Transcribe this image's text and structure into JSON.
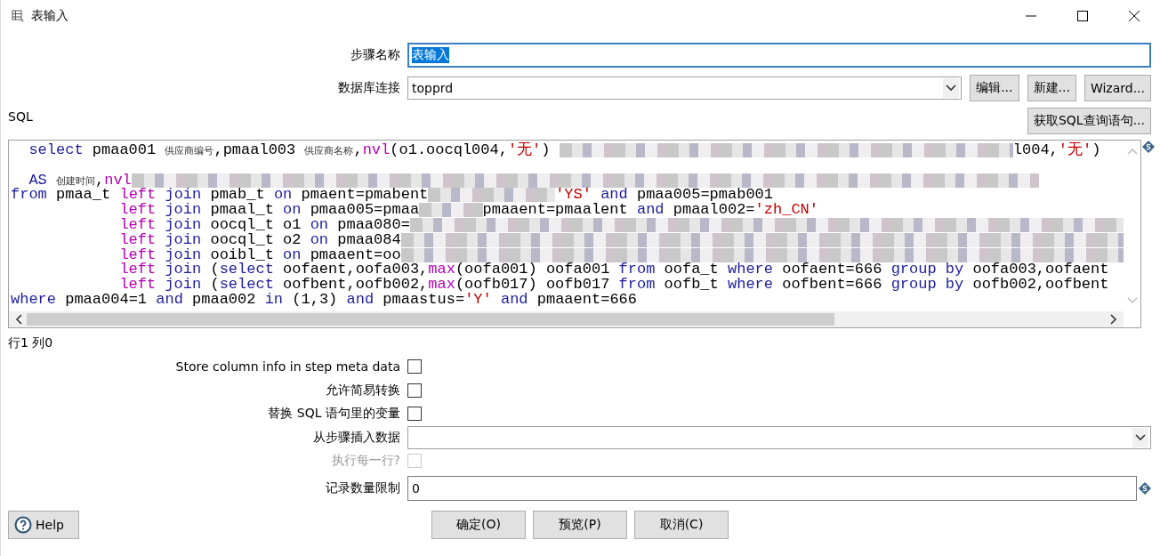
{
  "window": {
    "title": "表输入"
  },
  "step_name": {
    "label": "步骤名称",
    "value": "表输入",
    "selected": true
  },
  "connection": {
    "label": "数据库连接",
    "value": "topprd",
    "buttons": [
      "编辑...",
      "新建...",
      "Wizard..."
    ]
  },
  "sql": {
    "label": "SQL",
    "button": "获取SQL查询语句...",
    "lines": [
      {
        "kind": "lead",
        "tokens": [
          {
            "kind": "kw",
            "text": "select"
          },
          {
            "kind": "plain",
            "text": " pmaa001 "
          },
          {
            "kind": "cjk",
            "text": "供应商编号"
          },
          {
            "kind": "plain",
            "text": ",pmaal003 "
          },
          {
            "kind": "cjk",
            "text": "供应商名称"
          },
          {
            "kind": "plain",
            "text": ","
          },
          {
            "kind": "fn",
            "text": "nvl"
          },
          {
            "kind": "plain",
            "text": "(o1.oocql004,"
          },
          {
            "kind": "str",
            "text": "'无'"
          },
          {
            "kind": "plain",
            "text": ") "
          },
          {
            "kind": "mosaic"
          },
          {
            "kind": "plain",
            "text": "l004,"
          },
          {
            "kind": "str",
            "text": "'无'"
          },
          {
            "kind": "plain",
            "text": ")"
          }
        ]
      },
      {
        "kind": "blank"
      },
      {
        "kind": "lead",
        "tokens": [
          {
            "kind": "kw",
            "text": "AS "
          },
          {
            "kind": "cjk",
            "text": "创建时间"
          },
          {
            "kind": "plain",
            "text": ","
          },
          {
            "kind": "fn",
            "text": "nvl"
          },
          {
            "kind": "mosaic"
          }
        ]
      },
      {
        "kind": "flush",
        "tokens": [
          {
            "kind": "kw",
            "text": "from"
          },
          {
            "kind": "plain",
            "text": " pmaa_t "
          },
          {
            "kind": "fn",
            "text": "left "
          },
          {
            "kind": "kw",
            "text": "join"
          },
          {
            "kind": "plain",
            "text": " pmab_t "
          },
          {
            "kind": "kw",
            "text": "on"
          },
          {
            "kind": "plain",
            "text": " pmaent=pmabent"
          },
          {
            "kind": "mosaic"
          },
          {
            "kind": "str",
            "text": "'YS'"
          },
          {
            "kind": "kw",
            "text": " and"
          },
          {
            "kind": "plain",
            "text": " pmaa005=pmab001"
          }
        ]
      },
      {
        "kind": "nested",
        "tokens": [
          {
            "kind": "fn",
            "text": "left "
          },
          {
            "kind": "kw",
            "text": "join"
          },
          {
            "kind": "plain",
            "text": " pmaal_t "
          },
          {
            "kind": "kw",
            "text": "on"
          },
          {
            "kind": "plain",
            "text": " pmaa005=pmaa"
          },
          {
            "kind": "mosaic"
          },
          {
            "kind": "plain",
            "text": "pmaaent=pmaalent "
          },
          {
            "kind": "kw",
            "text": "and"
          },
          {
            "kind": "plain",
            "text": " pmaal002="
          },
          {
            "kind": "str",
            "text": "'zh_CN'"
          }
        ]
      },
      {
        "kind": "nested",
        "tokens": [
          {
            "kind": "fn",
            "text": "left "
          },
          {
            "kind": "kw",
            "text": "join"
          },
          {
            "kind": "plain",
            "text": " oocql_t o1 "
          },
          {
            "kind": "kw",
            "text": "on"
          },
          {
            "kind": "plain",
            "text": " pmaa080="
          },
          {
            "kind": "mosaic"
          }
        ]
      },
      {
        "kind": "nested",
        "tokens": [
          {
            "kind": "fn",
            "text": "left "
          },
          {
            "kind": "kw",
            "text": "join"
          },
          {
            "kind": "plain",
            "text": " oocql_t o2 "
          },
          {
            "kind": "kw",
            "text": "on"
          },
          {
            "kind": "plain",
            "text": " pmaa084"
          },
          {
            "kind": "mosaic"
          }
        ]
      },
      {
        "kind": "nested",
        "tokens": [
          {
            "kind": "fn",
            "text": "left "
          },
          {
            "kind": "kw",
            "text": "join"
          },
          {
            "kind": "plain",
            "text": " ooibl_t "
          },
          {
            "kind": "kw",
            "text": "on"
          },
          {
            "kind": "plain",
            "text": " pmaaent=oo"
          },
          {
            "kind": "mosaic"
          }
        ]
      },
      {
        "kind": "nested",
        "tokens": [
          {
            "kind": "fn",
            "text": "left "
          },
          {
            "kind": "kw",
            "text": "join"
          },
          {
            "kind": "plain",
            "text": " ("
          },
          {
            "kind": "kw",
            "text": "select"
          },
          {
            "kind": "plain",
            "text": " oofaent,oofa003,"
          },
          {
            "kind": "fn",
            "text": "max"
          },
          {
            "kind": "plain",
            "text": "(oofa001) oofa001 "
          },
          {
            "kind": "kw",
            "text": "from"
          },
          {
            "kind": "plain",
            "text": " oofa_t "
          },
          {
            "kind": "kw",
            "text": "where"
          },
          {
            "kind": "plain",
            "text": " oofaent=666 "
          },
          {
            "kind": "kw",
            "text": "group by"
          },
          {
            "kind": "plain",
            "text": " oofa003,oofaent"
          }
        ]
      },
      {
        "kind": "nested",
        "tokens": [
          {
            "kind": "fn",
            "text": "left "
          },
          {
            "kind": "kw",
            "text": "join"
          },
          {
            "kind": "plain",
            "text": " ("
          },
          {
            "kind": "kw",
            "text": "select"
          },
          {
            "kind": "plain",
            "text": " oofbent,oofb002,"
          },
          {
            "kind": "fn",
            "text": "max"
          },
          {
            "kind": "plain",
            "text": "(oofb017) oofb017 "
          },
          {
            "kind": "kw",
            "text": "from"
          },
          {
            "kind": "plain",
            "text": " oofb_t "
          },
          {
            "kind": "kw",
            "text": "where"
          },
          {
            "kind": "plain",
            "text": " oofbent=666 "
          },
          {
            "kind": "kw",
            "text": "group by"
          },
          {
            "kind": "plain",
            "text": " oofb002,oofbent"
          }
        ]
      },
      {
        "kind": "flush",
        "tokens": [
          {
            "kind": "kw",
            "text": "where"
          },
          {
            "kind": "plain",
            "text": " pmaa004=1 "
          },
          {
            "kind": "kw",
            "text": "and"
          },
          {
            "kind": "plain",
            "text": " pmaa002 "
          },
          {
            "kind": "kw",
            "text": "in"
          },
          {
            "kind": "plain",
            "text": " (1,3) "
          },
          {
            "kind": "kw",
            "text": "and"
          },
          {
            "kind": "plain",
            "text": " pmaastus="
          },
          {
            "kind": "str",
            "text": "'Y'"
          },
          {
            "kind": "kw",
            "text": " and"
          },
          {
            "kind": "plain",
            "text": " pmaaent=666"
          }
        ]
      }
    ]
  },
  "cursor_position": "行1 列0",
  "options": [
    {
      "kind": "checkbox",
      "label": "Store column info in step meta data",
      "checked": false,
      "disabled": false
    },
    {
      "kind": "checkbox",
      "label": "允许简易转换",
      "checked": false,
      "disabled": false
    },
    {
      "kind": "checkbox",
      "label": "替换 SQL 语句里的变量",
      "checked": false,
      "disabled": false
    },
    {
      "kind": "combo",
      "label": "从步骤插入数据"
    },
    {
      "kind": "checkbox",
      "label": "执行每一行?",
      "checked": false,
      "disabled": true
    },
    {
      "kind": "text",
      "label": "记录数量限制",
      "value": "0"
    }
  ],
  "footer": {
    "help": "Help",
    "actions": [
      "确定(O)",
      "预览(P)",
      "取消(C)"
    ]
  }
}
